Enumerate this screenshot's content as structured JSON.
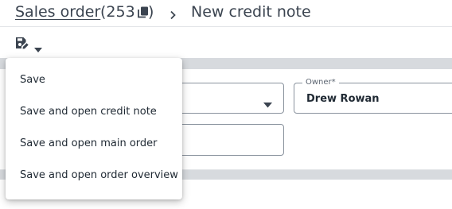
{
  "breadcrumb": {
    "parent_label": "Sales order",
    "count_open": "(253",
    "count_close": ")",
    "current_label": "New credit note"
  },
  "toolbar": {
    "save_icon": "save-edit-icon",
    "caret_icon": "caret-down-icon"
  },
  "form": {
    "owner": {
      "label": "Owner*",
      "value": "Drew Rowan"
    }
  },
  "save_menu": {
    "items": [
      {
        "label": "Save"
      },
      {
        "label": "Save and open credit note"
      },
      {
        "label": "Save and open main order"
      },
      {
        "label": "Save and open order overview"
      }
    ]
  },
  "colors": {
    "text": "#1f2933",
    "header_text": "#3b4450",
    "band": "#d7dade",
    "border": "#8a939e"
  }
}
